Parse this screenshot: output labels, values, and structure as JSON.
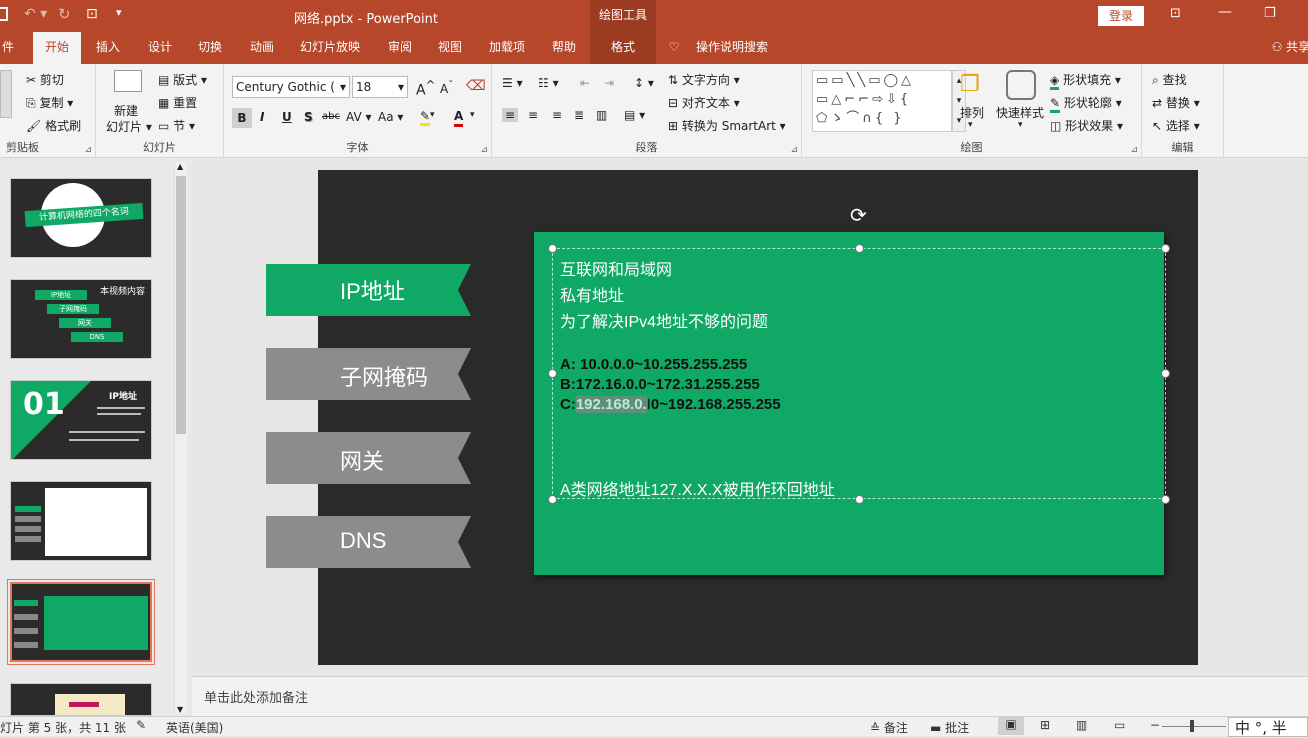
{
  "titlebar": {
    "doc_title": "网络.pptx  -  PowerPoint",
    "context_tool": "绘图工具",
    "login": "登录"
  },
  "tabs": [
    "件",
    "开始",
    "插入",
    "设计",
    "切换",
    "动画",
    "幻灯片放映",
    "审阅",
    "视图",
    "加载项",
    "帮助",
    "格式"
  ],
  "tell_me": "操作说明搜索",
  "share": "共享",
  "ribbon": {
    "clipboard": {
      "cut": "剪切",
      "copy": "复制",
      "format_painter": "格式刷",
      "label": "剪贴板"
    },
    "slides": {
      "new_slide_1": "新建",
      "new_slide_2": "幻灯片",
      "layout": "版式",
      "reset": "重置",
      "section": "节",
      "label": "幻灯片"
    },
    "font": {
      "name": "Century Gothic (",
      "size": "18",
      "label": "字体",
      "bold": "B",
      "italic": "I",
      "underline": "U",
      "shadow": "S",
      "strike": "abc",
      "spacing": "AV",
      "case": "Aa",
      "grow": "A",
      "shrink": "A"
    },
    "paragraph": {
      "text_direction": "文字方向",
      "align_text": "对齐文本",
      "smartart": "转换为 SmartArt",
      "label": "段落"
    },
    "drawing": {
      "arrange": "排列",
      "quick_styles": "快速样式",
      "fill": "形状填充",
      "outline": "形状轮廓",
      "effects": "形状效果",
      "label": "绘图"
    },
    "editing": {
      "find": "查找",
      "replace": "替换",
      "select": "选择",
      "label": "编辑"
    }
  },
  "thumbnails": [
    {
      "title": "计算机网络的四个名词"
    },
    {
      "title": "本视频内容",
      "items": [
        "IP地址",
        "子网掩码",
        "网关",
        "DNS"
      ]
    },
    {
      "number": "01",
      "title": "IP地址"
    },
    {},
    {},
    {}
  ],
  "slide": {
    "labels": [
      "IP地址",
      "子网掩码",
      "网关",
      "DNS"
    ],
    "lines": [
      "互联网和局域网",
      "私有地址",
      "为了解决IPv4地址不够的问题"
    ],
    "ranges": {
      "a": "A: 10.0.0.0~10.255.255.255",
      "b": "B:172.16.0.0~172.31.255.255",
      "c_prefix": "C:",
      "c_selected": "192.168.0.",
      "c_suffix": "0~192.168.255.255"
    },
    "loopback": "A类网络地址127.X.X.X被用作环回地址"
  },
  "notes_placeholder": "单击此处添加备注",
  "status": {
    "slide_info": "灯片 第 5 张，共 11 张",
    "language": "英语(美国)",
    "notes_btn": "备注",
    "comments_btn": "批注",
    "ime": "中 °, 半"
  },
  "colors": {
    "accent": "#b7472a",
    "green": "#0fa865",
    "gray_label": "#8c8c8c"
  }
}
